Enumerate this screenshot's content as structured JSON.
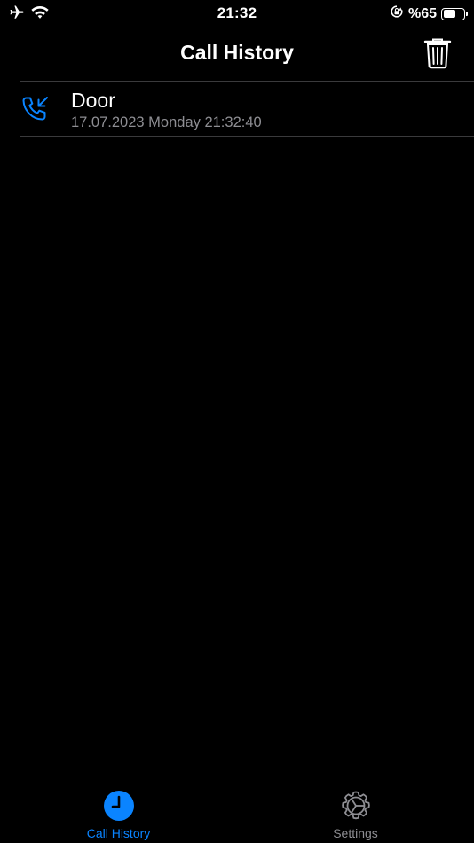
{
  "status_bar": {
    "time": "21:32",
    "battery_text": "%65",
    "battery_level_percent": 65,
    "icons": [
      "airplane-icon",
      "wifi-icon",
      "orientation-lock-icon",
      "battery-icon"
    ]
  },
  "nav": {
    "title": "Call History",
    "trash_icon": "trash-icon"
  },
  "calls": [
    {
      "name": "Door",
      "datetime": "17.07.2023 Monday 21:32:40",
      "direction": "incoming",
      "icon": "incoming-call-icon"
    }
  ],
  "tabs": [
    {
      "label": "Call History",
      "icon": "clock-icon",
      "active": true
    },
    {
      "label": "Settings",
      "icon": "gear-icon",
      "active": false
    }
  ],
  "colors": {
    "background": "#000000",
    "accent": "#0a84ff",
    "secondary_text": "#8e8e93",
    "divider": "#3a3a3c"
  }
}
